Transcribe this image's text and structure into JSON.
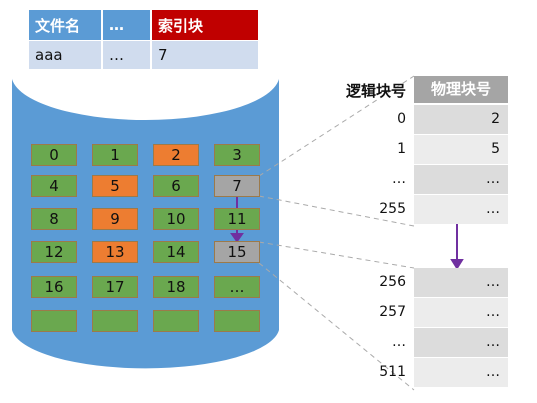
{
  "fcb": {
    "headers": [
      "文件名",
      "…",
      "索引块"
    ],
    "row": [
      "aaa",
      "…",
      "7"
    ]
  },
  "blocks": [
    {
      "n": "0",
      "c": "green"
    },
    {
      "n": "1",
      "c": "green"
    },
    {
      "n": "2",
      "c": "orange"
    },
    {
      "n": "3",
      "c": "green"
    },
    {
      "n": "4",
      "c": "green"
    },
    {
      "n": "5",
      "c": "orange"
    },
    {
      "n": "6",
      "c": "green"
    },
    {
      "n": "7",
      "c": "gray"
    },
    {
      "n": "8",
      "c": "green"
    },
    {
      "n": "9",
      "c": "orange"
    },
    {
      "n": "10",
      "c": "green"
    },
    {
      "n": "11",
      "c": "green"
    },
    {
      "n": "12",
      "c": "green"
    },
    {
      "n": "13",
      "c": "orange"
    },
    {
      "n": "14",
      "c": "green"
    },
    {
      "n": "15",
      "c": "gray"
    },
    {
      "n": "16",
      "c": "green"
    },
    {
      "n": "17",
      "c": "green"
    },
    {
      "n": "18",
      "c": "green"
    },
    {
      "n": "…",
      "c": "green"
    },
    {
      "n": "",
      "c": "green"
    },
    {
      "n": "",
      "c": "green"
    },
    {
      "n": "",
      "c": "green"
    },
    {
      "n": "",
      "c": "green"
    }
  ],
  "index": {
    "logical_header": "逻辑块号",
    "physical_header": "物理块号",
    "rows1": [
      {
        "l": "0",
        "p": "2"
      },
      {
        "l": "1",
        "p": "5"
      },
      {
        "l": "…",
        "p": "…"
      },
      {
        "l": "255",
        "p": "…"
      }
    ],
    "rows2": [
      {
        "l": "256",
        "p": "…"
      },
      {
        "l": "257",
        "p": "…"
      },
      {
        "l": "…",
        "p": "…"
      },
      {
        "l": "511",
        "p": "…"
      }
    ]
  },
  "colors": {
    "disk": "#5b9bd5",
    "free": "#6aa84f",
    "used": "#ed7d31",
    "index": "#a5a5a5",
    "highlight": "#c00000",
    "arrow": "#7030a0"
  }
}
